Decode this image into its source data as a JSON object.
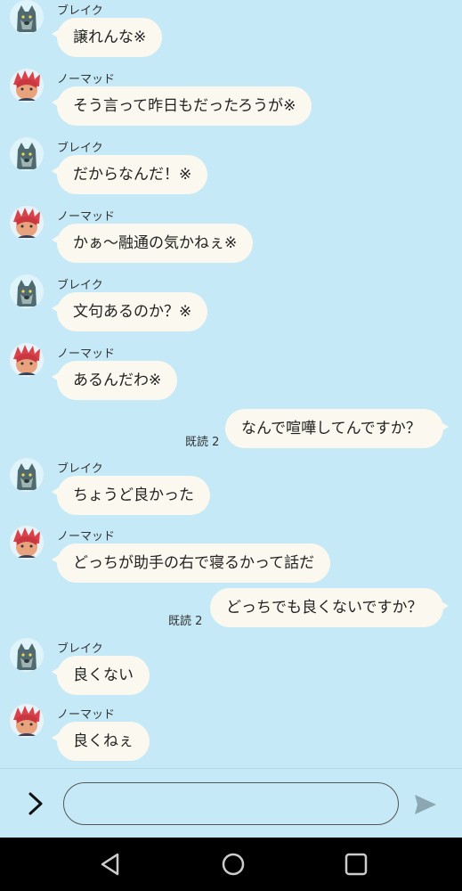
{
  "chat": {
    "messages": [
      {
        "side": "in",
        "sender": "ブレイク",
        "text": "譲れんな※",
        "avatar": "wolf-avatar"
      },
      {
        "side": "in",
        "sender": "ノーマッド",
        "text": "そう言って昨日もだったろうが※",
        "avatar": "red-haired-avatar"
      },
      {
        "side": "in",
        "sender": "ブレイク",
        "text": "だからなんだ！※",
        "avatar": "wolf-avatar"
      },
      {
        "side": "in",
        "sender": "ノーマッド",
        "text": "かぁ〜融通の気かねぇ※",
        "avatar": "red-haired-avatar"
      },
      {
        "side": "in",
        "sender": "ブレイク",
        "text": "文句あるのか？※",
        "avatar": "wolf-avatar"
      },
      {
        "side": "in",
        "sender": "ノーマッド",
        "text": "あるんだわ※",
        "avatar": "red-haired-avatar"
      },
      {
        "side": "out",
        "text": "なんで喧嘩してんですか？",
        "read": "既読 2"
      },
      {
        "side": "in",
        "sender": "ブレイク",
        "text": "ちょうど良かった",
        "avatar": "wolf-avatar"
      },
      {
        "side": "in",
        "sender": "ノーマッド",
        "text": "どっちが助手の右で寝るかって話だ",
        "avatar": "red-haired-avatar"
      },
      {
        "side": "out",
        "text": "どっちでも良くないですか？",
        "read": "既読 2"
      },
      {
        "side": "in",
        "sender": "ブレイク",
        "text": "良くない",
        "avatar": "wolf-avatar"
      },
      {
        "side": "in",
        "sender": "ノーマッド",
        "text": "良くねぇ",
        "avatar": "red-haired-avatar"
      }
    ]
  },
  "input_bar": {
    "expand_icon": "chevron-right-icon",
    "input_value": "",
    "input_placeholder": "",
    "send_icon": "send-icon"
  },
  "nav_bar": {
    "icons": [
      "back-triangle-icon",
      "home-circle-icon",
      "recents-square-icon"
    ]
  },
  "colors": {
    "background": "#c5e9f7",
    "bubble": "#fbf9ef",
    "navbar": "#000000"
  }
}
